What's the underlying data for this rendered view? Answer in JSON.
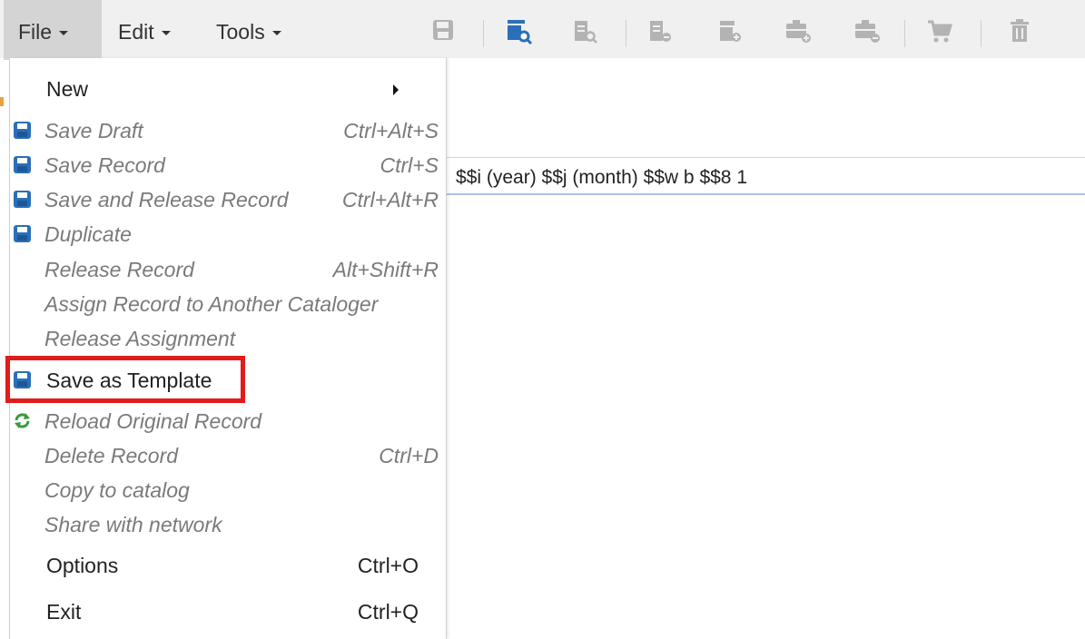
{
  "menubar": {
    "file": "File",
    "edit": "Edit",
    "tools": "Tools"
  },
  "toolbar": {
    "icons": [
      "save-icon",
      "search-record-icon",
      "record-search-icon",
      "record-copy-icon",
      "record-add-icon",
      "folder-add-icon",
      "folder-remove-icon",
      "cart-icon",
      "trash-icon"
    ],
    "accent_color": "#2a6fb8",
    "disabled_color": "#b3b3b3"
  },
  "field": {
    "text": "$$i (year) $$j (month) $$w b $$8 1"
  },
  "file_menu": {
    "new": "New",
    "save_draft": {
      "label": "Save Draft",
      "shortcut": "Ctrl+Alt+S"
    },
    "save_record": {
      "label": "Save Record",
      "shortcut": "Ctrl+S"
    },
    "save_release": {
      "label": "Save and Release Record",
      "shortcut": "Ctrl+Alt+R"
    },
    "duplicate": {
      "label": "Duplicate"
    },
    "release_record": {
      "label": "Release Record",
      "shortcut": "Alt+Shift+R"
    },
    "assign_record": {
      "label": "Assign Record to Another Cataloger"
    },
    "release_assignment": {
      "label": "Release Assignment"
    },
    "save_template": {
      "label": "Save as Template"
    },
    "reload_original": {
      "label": "Reload Original Record"
    },
    "delete_record": {
      "label": "Delete Record",
      "shortcut": "Ctrl+D"
    },
    "copy_catalog": {
      "label": "Copy to catalog"
    },
    "share_network": {
      "label": "Share with network"
    },
    "options": {
      "label": "Options",
      "shortcut": "Ctrl+O"
    },
    "exit": {
      "label": "Exit",
      "shortcut": "Ctrl+Q"
    }
  },
  "highlight_color": "#e21b1b"
}
